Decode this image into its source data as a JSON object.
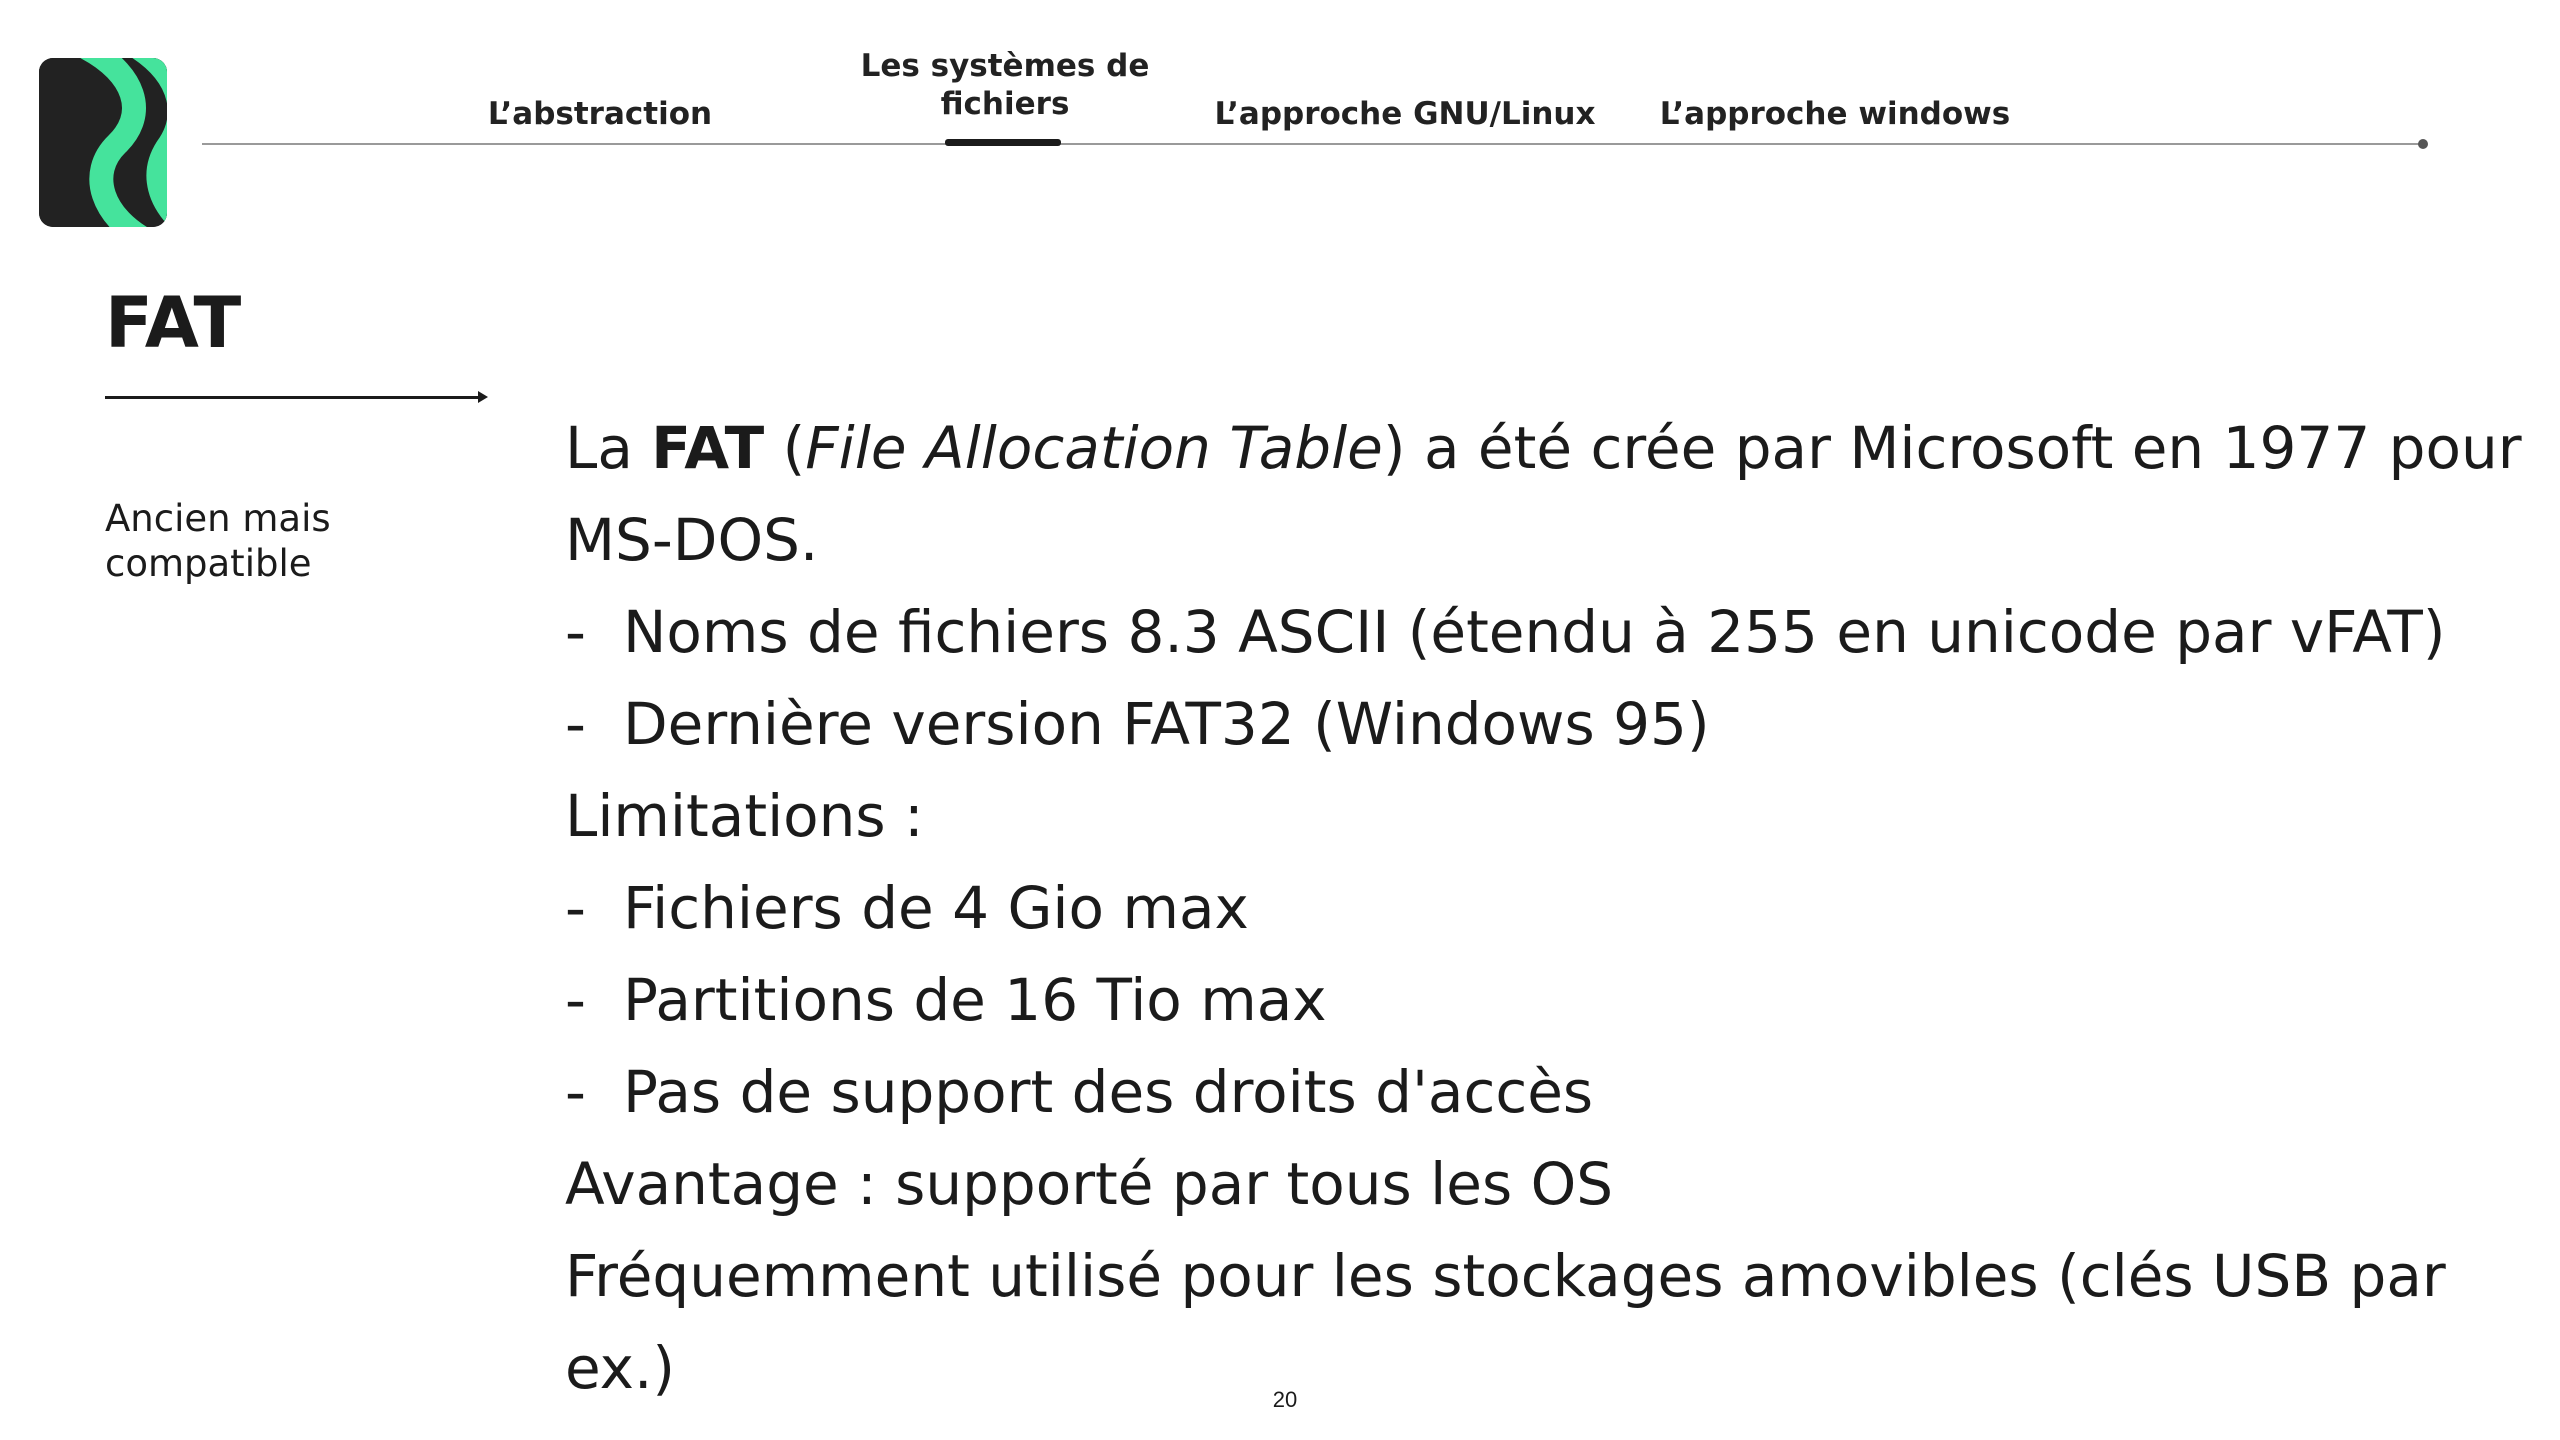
{
  "brand": {
    "logo_icon": "brand-logo-icon",
    "logo_bg_color": "#222222",
    "logo_accent_color": "#45e39c"
  },
  "nav": {
    "tabs": [
      {
        "label": "L’abstraction",
        "active": false
      },
      {
        "label": "Les systèmes de fichiers",
        "active": true
      },
      {
        "label": "L’approche GNU/Linux",
        "active": false
      },
      {
        "label": "L’approche windows",
        "active": false
      }
    ]
  },
  "slide": {
    "title": "FAT",
    "subtitle": "Ancien mais compatible",
    "intro": {
      "prefix": "La ",
      "bold": "FAT",
      "open_paren": " (",
      "italic": "File Allocation Table",
      "suffix": ") a été crée par Microsoft en 1977 pour MS-DOS."
    },
    "bullet_marker": "-",
    "bullets_1": [
      "Noms de fichiers 8.3 ASCII (étendu à 255 en unicode par vFAT)",
      "Dernière version FAT32 (Windows 95)"
    ],
    "limitations_heading": "Limitations :",
    "bullets_2": [
      "Fichiers de 4 Gio max",
      "Partitions de 16 Tio max",
      "Pas de support des droits d'accès"
    ],
    "advantage": "Avantage : supporté par tous les OS",
    "usage": "Fréquemment utilisé pour les stockages amovibles (clés USB par ex.)"
  },
  "page_number": "20"
}
